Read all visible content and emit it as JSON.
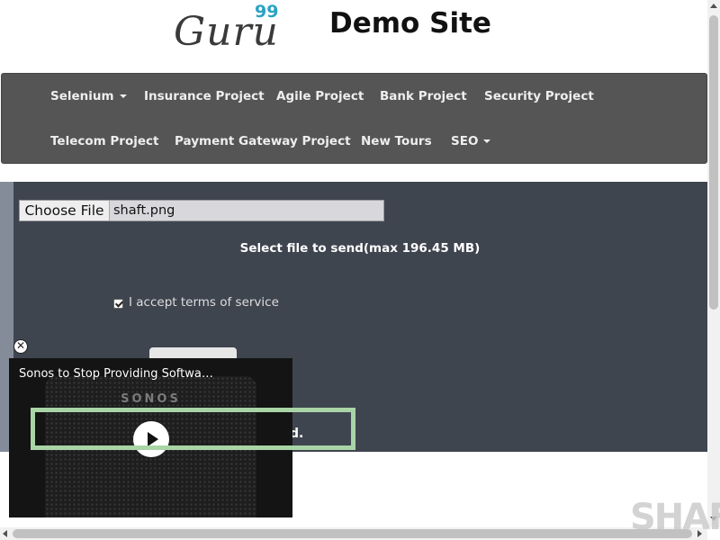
{
  "header": {
    "logo_text": "Guru",
    "logo_superscript": "99",
    "site_title": "Demo Site"
  },
  "nav": {
    "items": [
      {
        "label": "Selenium",
        "dropdown": true
      },
      {
        "label": "Insurance Project",
        "dropdown": false
      },
      {
        "label": "Agile Project",
        "dropdown": false
      },
      {
        "label": "Bank Project",
        "dropdown": false
      },
      {
        "label": "Security Project",
        "dropdown": false
      },
      {
        "label": "Telecom Project",
        "dropdown": false
      },
      {
        "label": "Payment Gateway Project",
        "dropdown": false
      },
      {
        "label": "New Tours",
        "dropdown": false
      },
      {
        "label": "SEO",
        "dropdown": true
      }
    ]
  },
  "upload": {
    "choose_file_label": "Choose File",
    "selected_file": "shaft.png",
    "max_size_text": "Select file to send(max 196.45 MB)",
    "terms_label": "I accept terms of service",
    "terms_checked": true,
    "result_text_visible": "d."
  },
  "video_ad": {
    "title": "Sonos to Stop Providing Softwa…",
    "brand": "SONOS",
    "close_icon": "close-circle-icon",
    "play_icon": "play-icon"
  },
  "watermark": {
    "text": "SHAFT"
  },
  "colors": {
    "navbar": "#555555",
    "panel": "#3f454f",
    "logo_accent": "#2aa3c4",
    "highlight": "#a9d4a6"
  }
}
